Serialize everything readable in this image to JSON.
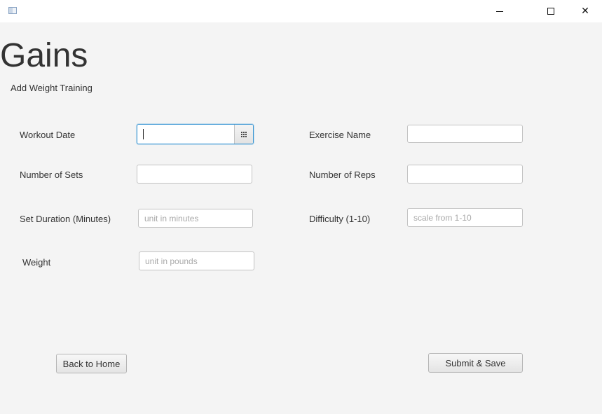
{
  "window": {
    "controls": {
      "minimize_icon": "minimize-icon",
      "maximize_icon": "maximize-icon",
      "close_icon": "close-icon",
      "close_glyph": "✕"
    }
  },
  "app": {
    "title": "Gains",
    "subtitle": "Add Weight Training"
  },
  "form": {
    "workout_date": {
      "label": "Workout Date",
      "value": "",
      "picker_icon": "calendar-icon"
    },
    "exercise_name": {
      "label": "Exercise Name",
      "value": "",
      "placeholder": ""
    },
    "number_of_sets": {
      "label": "Number of Sets",
      "value": "",
      "placeholder": ""
    },
    "number_of_reps": {
      "label": "Number of Reps",
      "value": "",
      "placeholder": ""
    },
    "set_duration": {
      "label": "Set Duration (Minutes)",
      "value": "",
      "placeholder": "unit in minutes"
    },
    "difficulty": {
      "label": "Difficulty (1-10)",
      "value": "",
      "placeholder": "scale from 1-10"
    },
    "weight": {
      "label": "Weight",
      "value": "",
      "placeholder": "unit in pounds"
    }
  },
  "actions": {
    "back_label": "Back to Home",
    "submit_label": "Submit & Save"
  },
  "colors": {
    "background": "#f4f4f4",
    "focus_border": "#3c97d4",
    "text": "#333333",
    "placeholder": "#a9a9a9"
  }
}
